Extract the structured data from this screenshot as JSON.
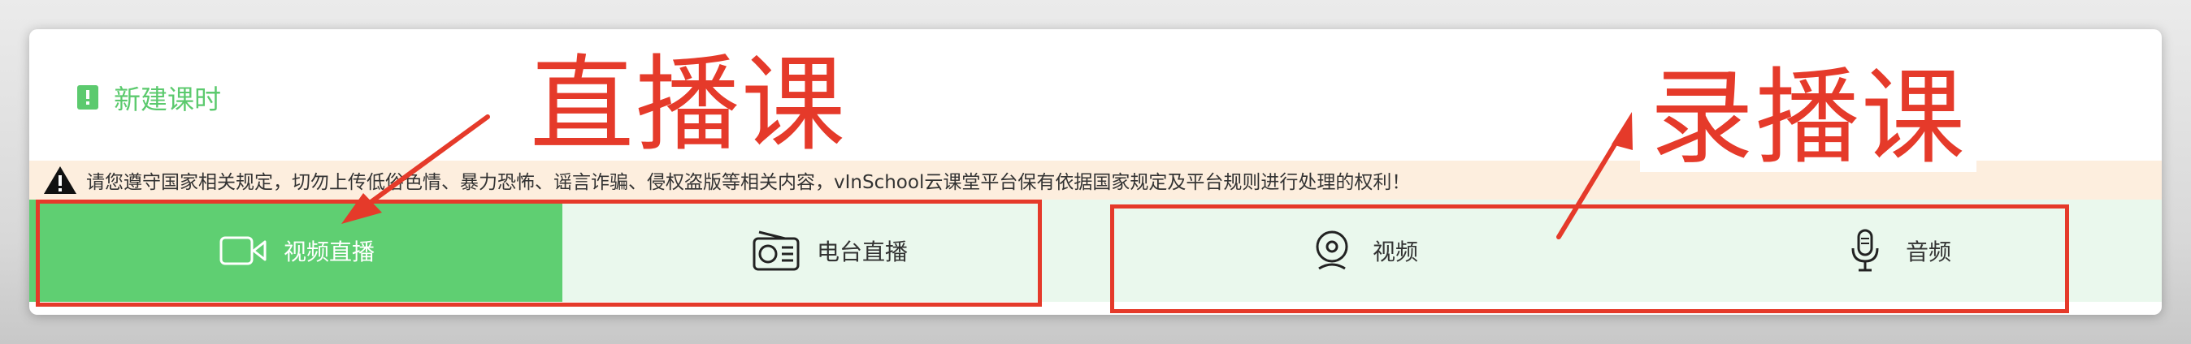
{
  "header": {
    "title": "新建课时",
    "title_icon": "clipboard-icon"
  },
  "notice": {
    "icon": "warning-icon",
    "text": "请您遵守国家相关规定，切勿上传低俗色情、暴力恐怖、谣言诈骗、侵权盗版等相关内容，vInSchool云课堂平台保有依据国家规定及平台规则进行处理的权利！"
  },
  "tabs": [
    {
      "label": "视频直播",
      "icon": "video-camera-icon",
      "active": true
    },
    {
      "label": "电台直播",
      "icon": "radio-icon",
      "active": false
    },
    {
      "label": "视频",
      "icon": "webcam-icon",
      "active": false
    },
    {
      "label": "音频",
      "icon": "microphone-icon",
      "active": false
    }
  ],
  "annotations": {
    "live_label": "直播课",
    "recorded_label": "录播课",
    "color": "#e53a2a"
  },
  "colors": {
    "accent": "#5fcf72",
    "title_green": "#5cca6e",
    "notice_bg": "#fdeede",
    "tab_bg": "#eaf8ed"
  }
}
